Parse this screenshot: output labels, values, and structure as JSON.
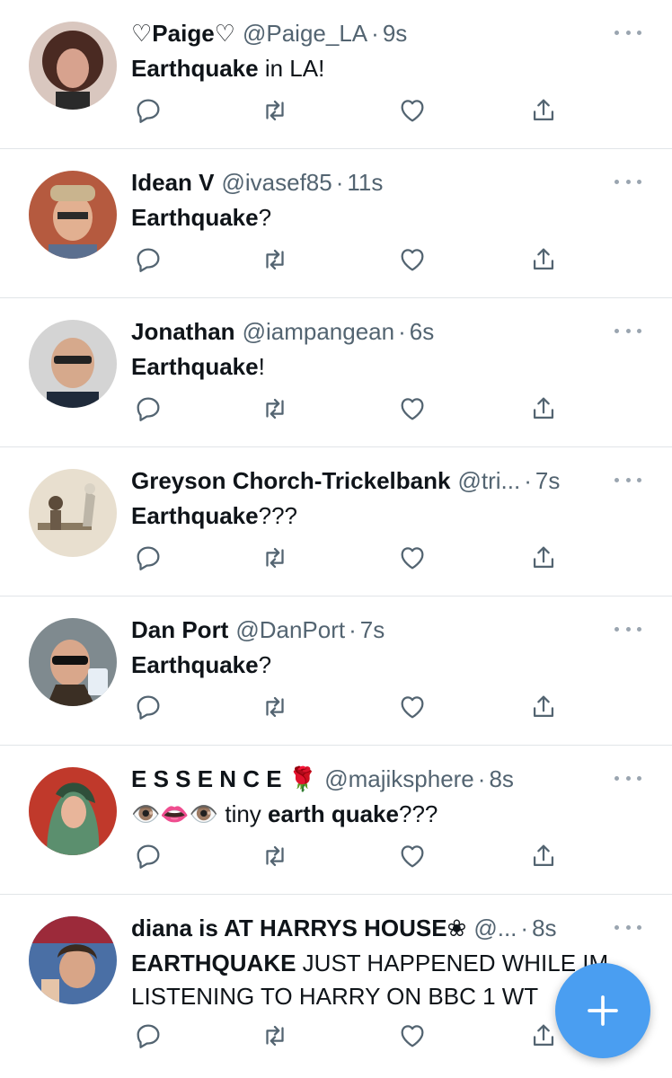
{
  "tweets": [
    {
      "name": "♡Paige♡",
      "handle": "@Paige_LA",
      "time": "9s",
      "text_bold": "Earthquake",
      "text_rest": " in LA!",
      "text2": ""
    },
    {
      "name": "Idean V",
      "handle": "@ivasef85",
      "time": "11s",
      "text_bold": "Earthquake",
      "text_rest": "?",
      "text2": ""
    },
    {
      "name": "Jonathan",
      "handle": "@iampangean",
      "time": "6s",
      "text_bold": "Earthquake",
      "text_rest": "!",
      "text2": ""
    },
    {
      "name": "Greyson Chorch-Trickelbank",
      "handle": "@tri...",
      "time": "7s",
      "text_bold": "Earthquake",
      "text_rest": "???",
      "text2": ""
    },
    {
      "name": "Dan Port",
      "handle": "@DanPort",
      "time": "7s",
      "text_bold": "Earthquake",
      "text_rest": "?",
      "text2": ""
    },
    {
      "name": "E S S E N C E 🌹",
      "handle": "@majiksphere",
      "time": "8s",
      "text_prefix": "👁️👄👁️ tiny ",
      "text_bold": "earth quake",
      "text_rest": "???",
      "text2": ""
    },
    {
      "name": "diana is AT HARRYS HOUSE❀",
      "handle": "@...",
      "time": "8s",
      "text_bold": "EARTHQUAKE",
      "text_rest": " JUST HAPPENED WHILE IM",
      "text2": "LISTENING TO HARRY ON BBC 1 WT"
    }
  ],
  "separator": "·",
  "icons": {
    "reply": "reply-icon",
    "retweet": "retweet-icon",
    "like": "like-icon",
    "share": "share-icon",
    "more": "more-icon",
    "compose": "compose-plus-icon"
  },
  "colors": {
    "accent": "#4a9ef1",
    "secondary_text": "#536471",
    "primary_text": "#0f1419"
  }
}
